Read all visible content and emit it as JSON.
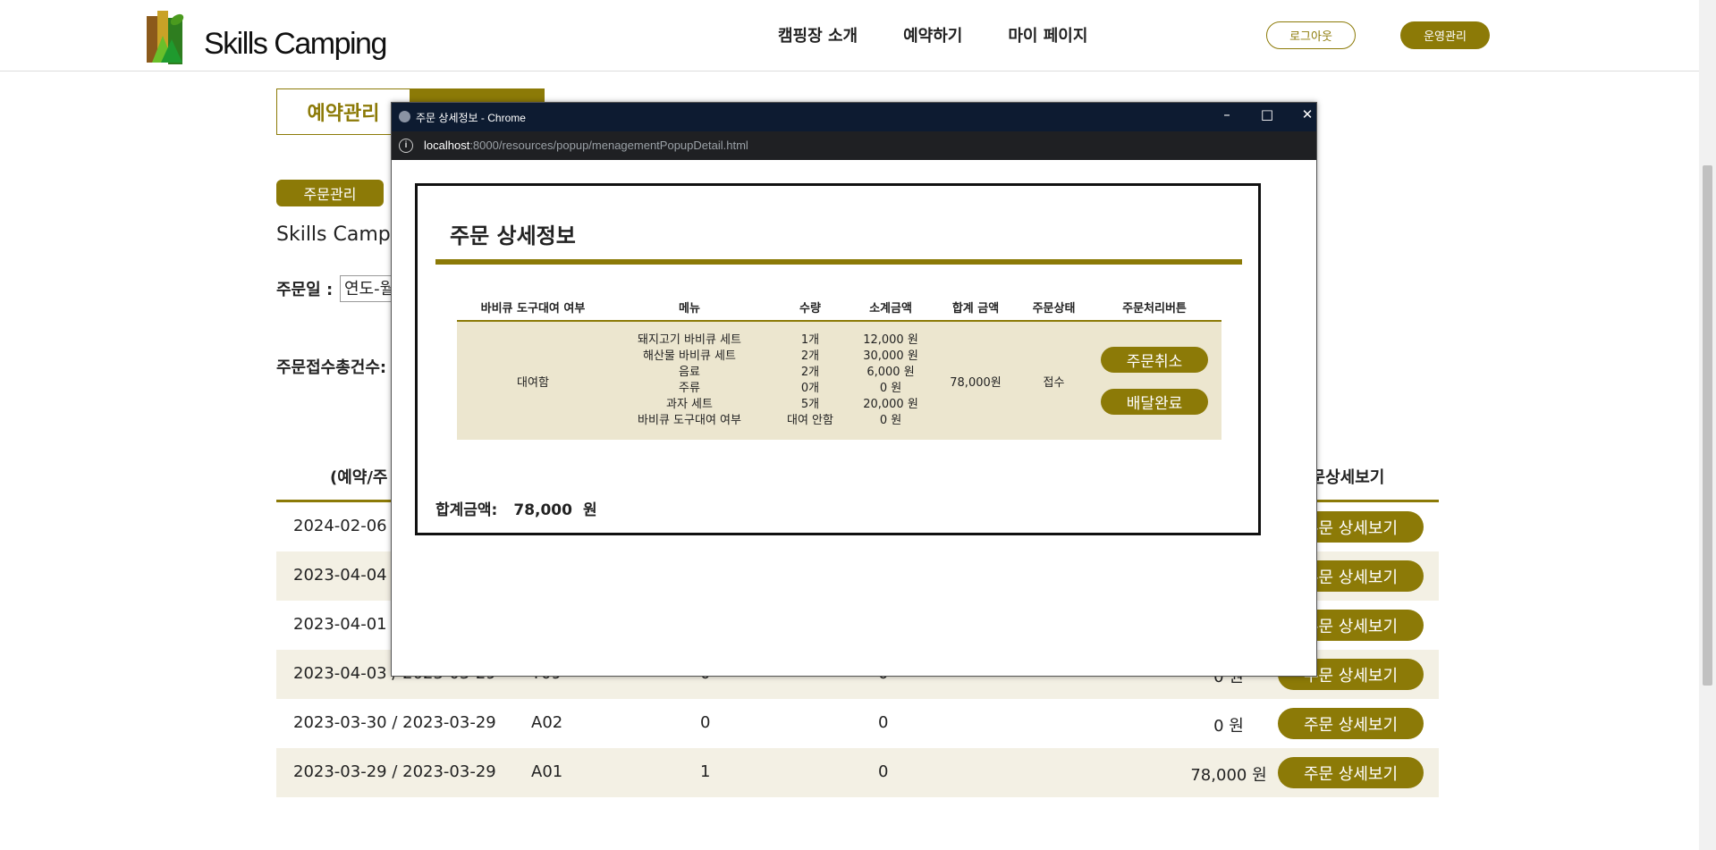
{
  "header": {
    "logo_text": "Skills Camping",
    "nav": [
      "캠핑장 소개",
      "예약하기",
      "마이 페이지"
    ],
    "logout_label": "로그아웃",
    "admin_label": "운영관리"
  },
  "page": {
    "tab_active": "예약관리",
    "sub_button": "주문관리",
    "title": "Skills Campi",
    "date_label": "주문일 :",
    "date_placeholder": "연도-월",
    "count_label": "주문접수총건수:",
    "table_headers": [
      "(예약/주",
      "주문상세보기"
    ],
    "rows": [
      {
        "date": "2024-02-06 /",
        "site": "",
        "a": "",
        "b": "",
        "amount": "",
        "button": "주문 상세보기"
      },
      {
        "date": "2023-04-04 /",
        "site": "",
        "a": "",
        "b": "",
        "amount": "",
        "button": "주문 상세보기"
      },
      {
        "date": "2023-04-01 /",
        "site": "",
        "a": "",
        "b": "",
        "amount": "",
        "button": "주문 상세보기"
      },
      {
        "date": "2023-04-03 / 2023-03-29",
        "site": "T09",
        "a": "0",
        "b": "0",
        "amount": "0 원",
        "button": "주문 상세보기"
      },
      {
        "date": "2023-03-30 / 2023-03-29",
        "site": "A02",
        "a": "0",
        "b": "0",
        "amount": "0 원",
        "button": "주문 상세보기"
      },
      {
        "date": "2023-03-29 / 2023-03-29",
        "site": "A01",
        "a": "1",
        "b": "0",
        "amount": "78,000 원",
        "button": "주문 상세보기"
      }
    ]
  },
  "popup": {
    "window_title": "주문 상세정보 - Chrome",
    "url_host": "localhost",
    "url_path": ":8000/resources/popup/menagementPopupDetail.html",
    "title": "주문 상세정보",
    "headers": [
      "바비큐 도구대여 여부",
      "메뉴",
      "수량",
      "소계금액",
      "합계 금액",
      "주문상태",
      "주문처리버튼"
    ],
    "rental": "대여함",
    "items": [
      {
        "menu": "돼지고기 바비큐 세트",
        "qty": "1개",
        "subtotal": "12,000 원"
      },
      {
        "menu": "해산물 바비큐 세트",
        "qty": "2개",
        "subtotal": "30,000 원"
      },
      {
        "menu": "음료",
        "qty": "2개",
        "subtotal": "6,000 원"
      },
      {
        "menu": "주류",
        "qty": "0개",
        "subtotal": "0 원"
      },
      {
        "menu": "과자 세트",
        "qty": "5개",
        "subtotal": "20,000 원"
      },
      {
        "menu": "바비큐 도구대여 여부",
        "qty": "대여 안함",
        "subtotal": "0 원"
      }
    ],
    "total_amount": "78,000원",
    "status": "접수",
    "cancel_label": "주문취소",
    "deliver_label": "배달완료",
    "footer_label": "합계금액:",
    "footer_value": "78,000",
    "footer_unit": "원"
  }
}
